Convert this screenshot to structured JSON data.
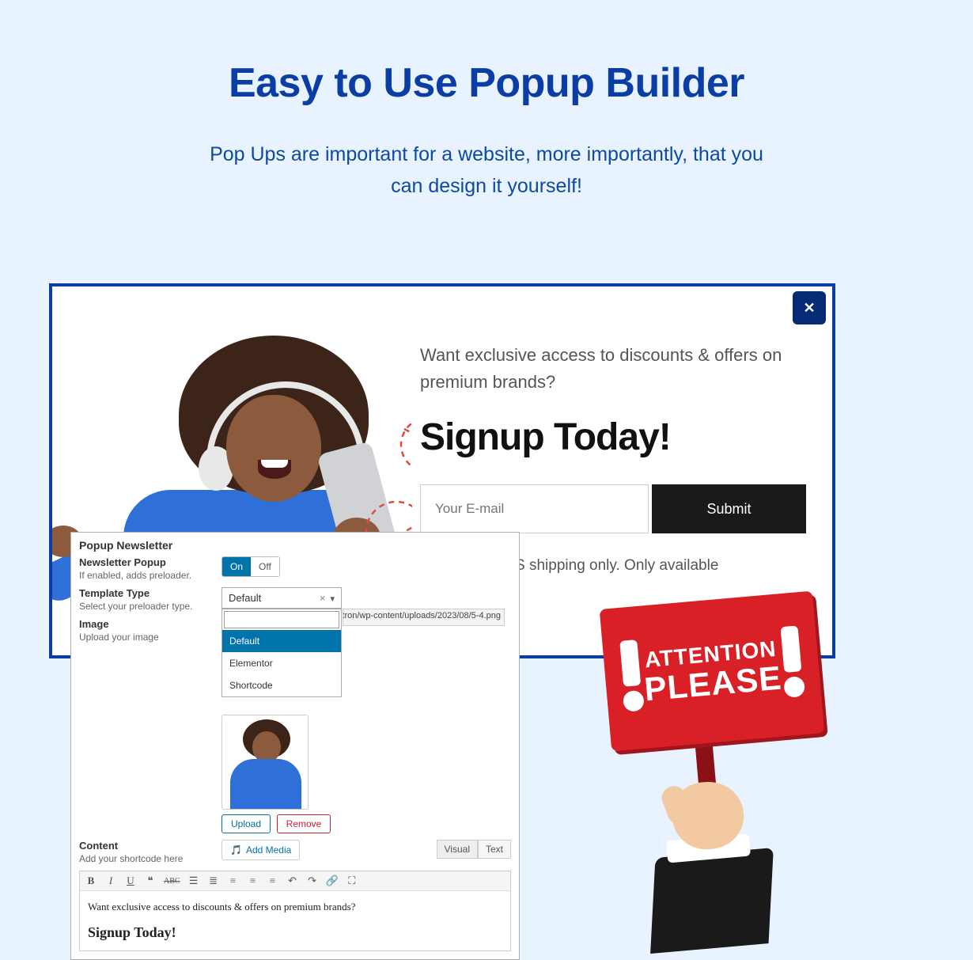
{
  "hero": {
    "title": "Easy to Use Popup Builder",
    "subtitle": "Pop Ups are important for a website, more importantly, that you can design it yourself!"
  },
  "popup": {
    "lead": "Want exclusive access to discounts & offers on premium brands?",
    "heading": "Signup Today!",
    "email_placeholder": "Your E-mail",
    "submit_label": "Submit",
    "disclaimer": "ffer. Free USPS shipping only. Only available",
    "close_label": "✕"
  },
  "admin": {
    "panel_title": "Popup Newsletter",
    "newsletter": {
      "label": "Newsletter Popup",
      "desc": "If enabled, adds preloader.",
      "on": "On",
      "off": "Off"
    },
    "template": {
      "label": "Template Type",
      "desc": "Select your preloader type.",
      "selected": "Default",
      "options": [
        "Default",
        "Elementor",
        "Shortcode"
      ]
    },
    "image": {
      "label": "Image",
      "desc": "Upload your image",
      "path": "ectron/wp-content/uploads/2023/08/5-4.png",
      "upload": "Upload",
      "remove": "Remove"
    },
    "content": {
      "label": "Content",
      "desc": "Add your shortcode here",
      "add_media": "Add Media",
      "tabs": {
        "visual": "Visual",
        "text": "Text"
      },
      "body_line1": "Want exclusive access to discounts & offers on premium brands?",
      "body_line2": "Signup Today!"
    }
  },
  "sign": {
    "line1": "ATTENTION",
    "line2": "PLEASE"
  }
}
